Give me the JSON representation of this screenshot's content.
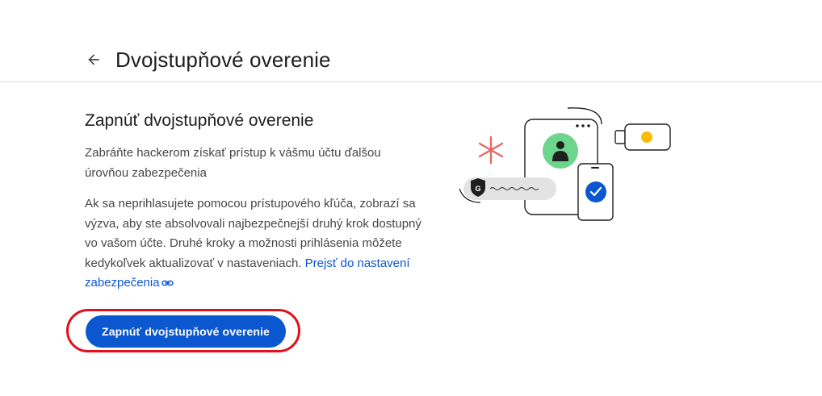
{
  "header": {
    "back_icon": "arrow-back-icon",
    "title": "Dvojstupňové overenie"
  },
  "main": {
    "section_title": "Zapnúť dvojstupňové overenie",
    "paragraph1": "Zabráňte hackerom získať prístup k vášmu účtu ďalšou úrovňou zabezpečenia",
    "paragraph2": "Ak sa neprihlasujete pomocou prístupového kľúča, zobrazí sa výzva, aby ste absolvovali najbezpečnejší druhý krok dostupný vo vašom účte. Druhé kroky a možnosti prihlásenia môžete kedykoľvek aktualizovať v nastaveniach.",
    "link_text": "Prejsť do nastavení zabezpečenia",
    "link_icon": "link-icon",
    "button_label": "Zapnúť dvojstupňové overenie"
  },
  "illustration": {
    "g_badge_letter": "G",
    "colors": {
      "accent_blue": "#0b57d0",
      "avatar_green": "#6dd58c",
      "key_yellow": "#fbbc04",
      "asterisk_red": "#e46962",
      "highlight_red": "#e0101e"
    }
  }
}
